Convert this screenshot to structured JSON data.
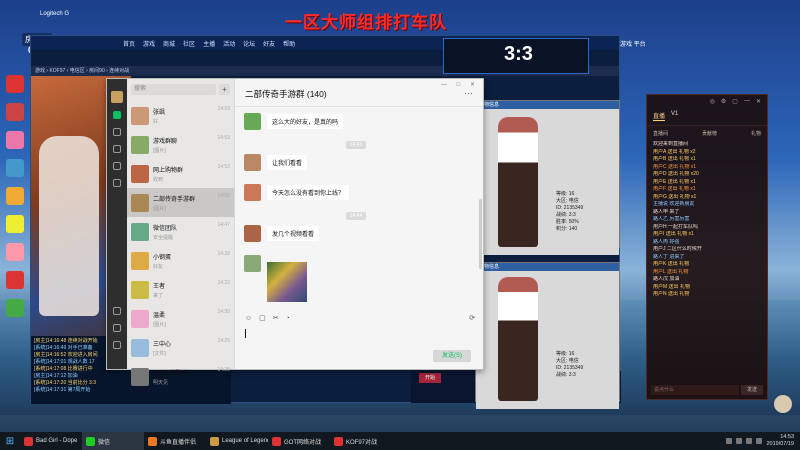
{
  "overlay_title": "一区大师组排打车队",
  "stream": {
    "badge": "房间号",
    "room_id": "087807"
  },
  "cast_label": "Logitech G",
  "desktop_icons": [
    {
      "label": "",
      "color": "#d33"
    },
    {
      "label": "",
      "color": "#c44"
    },
    {
      "label": "",
      "color": "#e7a"
    },
    {
      "label": "",
      "color": "#49c"
    },
    {
      "label": "",
      "color": "#ea3"
    },
    {
      "label": "",
      "color": "#ee3"
    },
    {
      "label": "",
      "color": "#f9a"
    },
    {
      "label": "",
      "color": "#d33"
    },
    {
      "label": "",
      "color": "#4a4"
    }
  ],
  "game": {
    "menu": [
      "首页",
      "游戏",
      "商城",
      "社区",
      "主播",
      "活动",
      "论坛",
      "好友",
      "帮助"
    ],
    "address": "游戏 › KOF97 › 电信区 › 房间90 › 连续对战",
    "score": "3:3",
    "btn": "开始",
    "chat_log": [
      {
        "text": "[房主]14:16:48 连续对战开始",
        "cls": ""
      },
      {
        "text": "[系统]14:16:49 对手已准备",
        "cls": "blue"
      },
      {
        "text": "[房主]14:16:52 欢迎进入房间",
        "cls": ""
      },
      {
        "text": "[系统]14:17:01 观战人数 17",
        "cls": "blue"
      },
      {
        "text": "[系统]14:17:08 比赛进行中",
        "cls": ""
      },
      {
        "text": "[房主]14:17:12 加油",
        "cls": "blue"
      },
      {
        "text": "[系统]14:17:20 当前比分 3:3",
        "cls": ""
      },
      {
        "text": "[系统]14:17:31 第7局开始",
        "cls": "blue"
      }
    ]
  },
  "char_windows": [
    {
      "title": "人物信息",
      "stats": [
        "等级: 16",
        "大区: 电信",
        "ID: 2135349",
        "战绩: 3:3",
        "胜率: 50%",
        "积分: 140"
      ]
    },
    {
      "title": "人物信息",
      "stats": [
        "等级: 16",
        "大区: 电信",
        "ID: 2135349",
        "战绩: 3:3"
      ]
    }
  ],
  "shield_label": "游戏\n平台",
  "wechat": {
    "search_placeholder": "搜索",
    "plus": "+",
    "title": "二部传奇手游群 (140)",
    "more": "···",
    "window_controls": "— □ ✕",
    "conversations": [
      {
        "name": "张飒",
        "preview": "好",
        "time": "14:53",
        "color": "#c97"
      },
      {
        "name": "游戏群聊",
        "preview": "[图片]",
        "time": "14:53",
        "color": "#8a6"
      },
      {
        "name": "网上购物群",
        "preview": "收到",
        "time": "14:52",
        "color": "#b64"
      },
      {
        "name": "二部传奇手游群",
        "preview": "[图片]",
        "time": "14:52",
        "color": "#a85"
      },
      {
        "name": "微信团队",
        "preview": "安全提醒",
        "time": "14:47",
        "color": "#6a8"
      },
      {
        "name": "小钢蛋",
        "preview": "好友",
        "time": "14:32",
        "color": "#da4"
      },
      {
        "name": "王者",
        "preview": "来了",
        "time": "14:32",
        "color": "#cb4"
      },
      {
        "name": "温柔",
        "preview": "[图片]",
        "time": "14:30",
        "color": "#eac"
      },
      {
        "name": "三中心",
        "preview": "[文件]",
        "time": "14:25",
        "color": "#9bd"
      },
      {
        "name": "37807战队群",
        "preview": "明天见",
        "time": "14:20",
        "color": "#777"
      }
    ],
    "messages": [
      {
        "sender": "",
        "text": "这么大的好友，是真的吗",
        "color": "#6a5"
      },
      {
        "system": "14:43"
      },
      {
        "sender": "",
        "text": "让我们看看",
        "color": "#b86"
      },
      {
        "sender": "",
        "text": "今天怎么没有看到你上线？",
        "color": "#c75"
      },
      {
        "system": "14:44"
      },
      {
        "sender": "",
        "text": "发几个视频看看",
        "color": "#a64"
      },
      {
        "photo": true,
        "sender": "",
        "color": "#8a7"
      }
    ],
    "toolbar": [
      "☺",
      "▢",
      "✂",
      "◔"
    ],
    "toolbar_right": "⟳",
    "send": "发送(S)"
  },
  "live_panel": {
    "controls": [
      "◎",
      "⚙",
      "▢",
      "—",
      "✕"
    ],
    "tabs": [
      "直播",
      "V1"
    ],
    "sub": [
      "直播间",
      "贡献榜",
      "礼物"
    ],
    "messages": [
      {
        "text": "欢迎来到直播间",
        "cls": "w"
      },
      {
        "text": "用户A 送出 礼物 x2",
        "cls": "y"
      },
      {
        "text": "用户B 送出 礼物 x1",
        "cls": "y"
      },
      {
        "text": "用户C 送出 礼物 x1",
        "cls": "o"
      },
      {
        "text": "用户D 送出 礼物 x20",
        "cls": "y"
      },
      {
        "text": "用户E 送出 礼物 x1",
        "cls": "y"
      },
      {
        "text": "用户F 送出 礼物 x1",
        "cls": "o"
      },
      {
        "text": "用户G 送出 礼物 x1",
        "cls": "y"
      },
      {
        "text": "主播说 欢迎新朋友",
        "cls": "b"
      },
      {
        "text": "路人甲 来了",
        "cls": "w"
      },
      {
        "text": "路人乙 厉害厉害",
        "cls": "b"
      },
      {
        "text": "用户H 一起打车队吗",
        "cls": "w"
      },
      {
        "text": "用户I 送出 礼物 x1",
        "cls": "y"
      },
      {
        "text": "路人丙 好强",
        "cls": "b"
      },
      {
        "text": "用户J 二区什么时候开",
        "cls": "w"
      },
      {
        "text": "路人丁 进来了",
        "cls": "b"
      },
      {
        "text": "用户K 送出 礼物",
        "cls": "y"
      },
      {
        "text": "用户L 送出 礼物",
        "cls": "o"
      },
      {
        "text": "路人戊 加油",
        "cls": "w"
      },
      {
        "text": "用户M 送出 礼物",
        "cls": "y"
      },
      {
        "text": "用户N 送出 礼物",
        "cls": "y"
      }
    ],
    "input": "说点什么",
    "send": "发送"
  },
  "taskbar": {
    "start_icon": "⊞",
    "apps": [
      {
        "label": "Bad Girl - Dope",
        "color": "#d33"
      },
      {
        "label": "微信",
        "color": "#2c2"
      },
      {
        "label": "斗鱼直播伴侣",
        "color": "#e72"
      },
      {
        "label": "League of Legends",
        "color": "#c94"
      },
      {
        "label": "GOT网络对战",
        "color": "#d33"
      },
      {
        "label": "KOF97对战",
        "color": "#d33"
      }
    ],
    "time": "14:53",
    "date": "2019/07/19"
  }
}
